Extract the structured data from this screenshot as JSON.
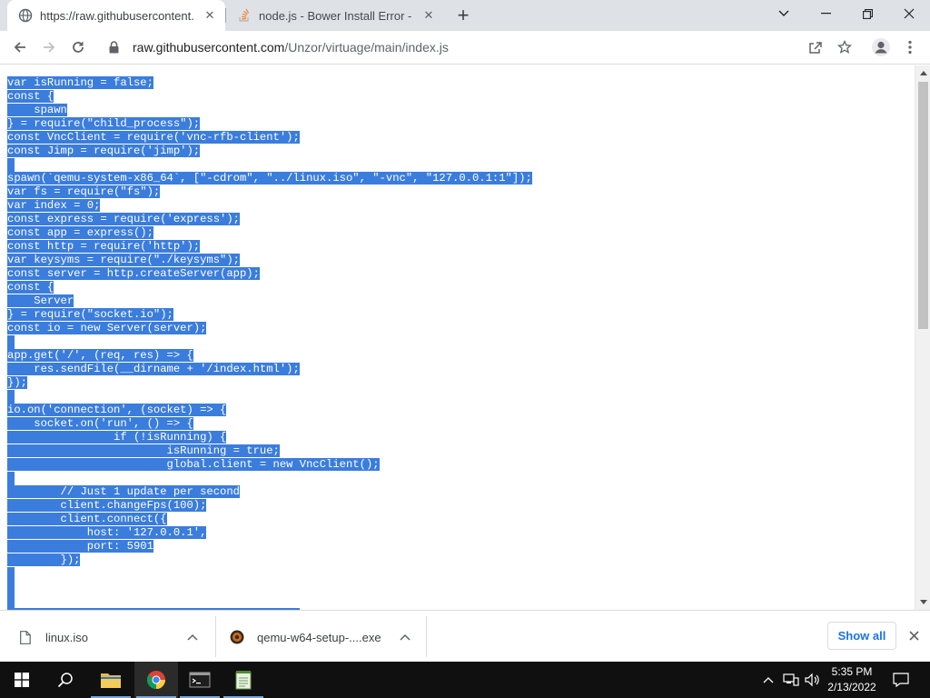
{
  "browser": {
    "tabs": [
      {
        "title": "https://raw.githubusercontent.co",
        "active": true
      },
      {
        "title": "node.js - Bower Install Error - Sta",
        "active": false
      }
    ],
    "address": {
      "host": "raw.githubusercontent.com",
      "path": "/Unzor/virtuage/main/index.js"
    }
  },
  "content": {
    "selection_color": "#3b7ddd",
    "code_lines": [
      "var isRunning = false;",
      "const {",
      "    spawn",
      "} = require(\"child_process\");",
      "const VncClient = require('vnc-rfb-client');",
      "const Jimp = require('jimp');",
      "",
      "spawn(`qemu-system-x86_64`, [\"-cdrom\", \"../linux.iso\", \"-vnc\", \"127.0.0.1:1\"]);",
      "var fs = require(\"fs\");",
      "var index = 0;",
      "const express = require('express');",
      "const app = express();",
      "const http = require('http');",
      "var keysyms = require(\"./keysyms\");",
      "const server = http.createServer(app);",
      "const {",
      "    Server",
      "} = require(\"socket.io\");",
      "const io = new Server(server);",
      "",
      "app.get('/', (req, res) => {",
      "    res.sendFile(__dirname + '/index.html');",
      "});",
      "",
      "io.on('connection', (socket) => {",
      "    socket.on('run', () => {",
      "                if (!isRunning) {",
      "                        isRunning = true;",
      "                        global.client = new VncClient();",
      "",
      "        // Just 1 update per second",
      "        client.changeFps(100);",
      "        client.connect({",
      "            host: '127.0.0.1',",
      "            port: 5901",
      "        });",
      "",
      "",
      ""
    ]
  },
  "downloads": {
    "items": [
      {
        "name": "linux.iso",
        "icon": "file-icon"
      },
      {
        "name": "qemu-w64-setup-....exe",
        "icon": "qemu-icon"
      }
    ],
    "show_all_label": "Show all"
  },
  "taskbar": {
    "time": "5:35 PM",
    "date": "2/13/2022"
  }
}
